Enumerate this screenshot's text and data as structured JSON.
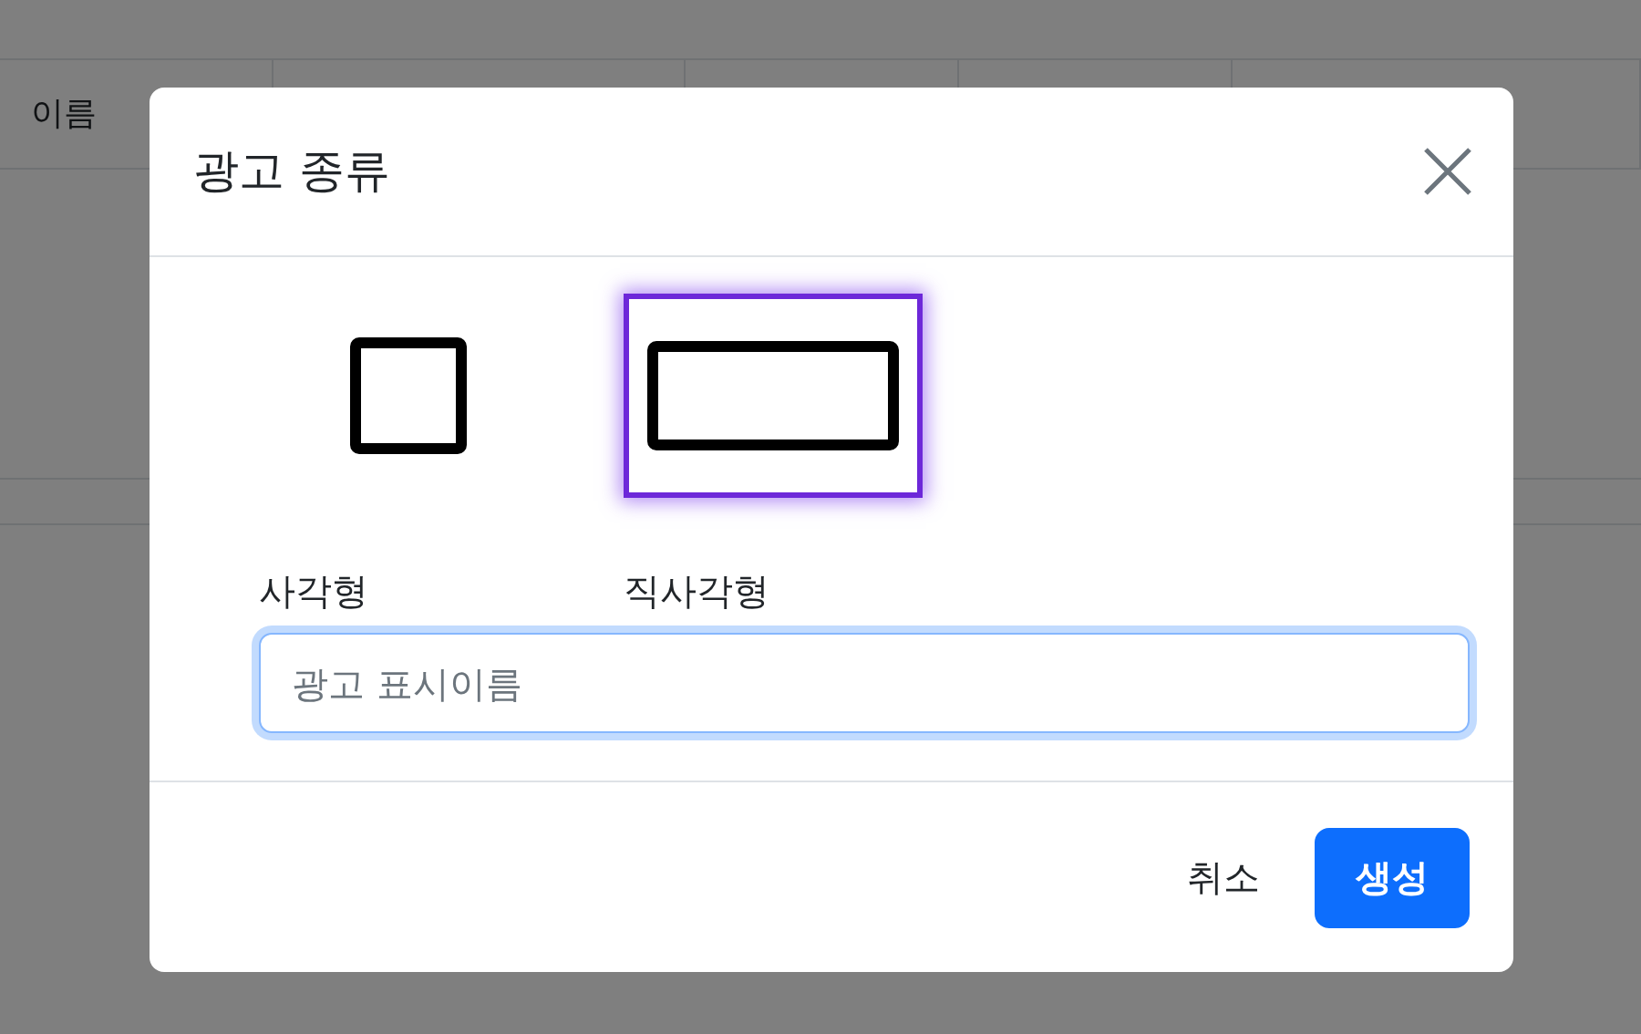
{
  "table": {
    "columns": [
      "이름",
      "",
      "",
      "",
      ""
    ]
  },
  "modal": {
    "title": "광고 종류",
    "options": [
      {
        "kind": "square",
        "label": "사각형",
        "selected": false
      },
      {
        "kind": "rectangle",
        "label": "직사각형",
        "selected": true
      }
    ],
    "name_field": {
      "placeholder": "광고 표시이름"
    },
    "buttons": [
      {
        "kind": "secondary",
        "label": "취소"
      },
      {
        "kind": "primary",
        "label": "생성"
      }
    ]
  }
}
